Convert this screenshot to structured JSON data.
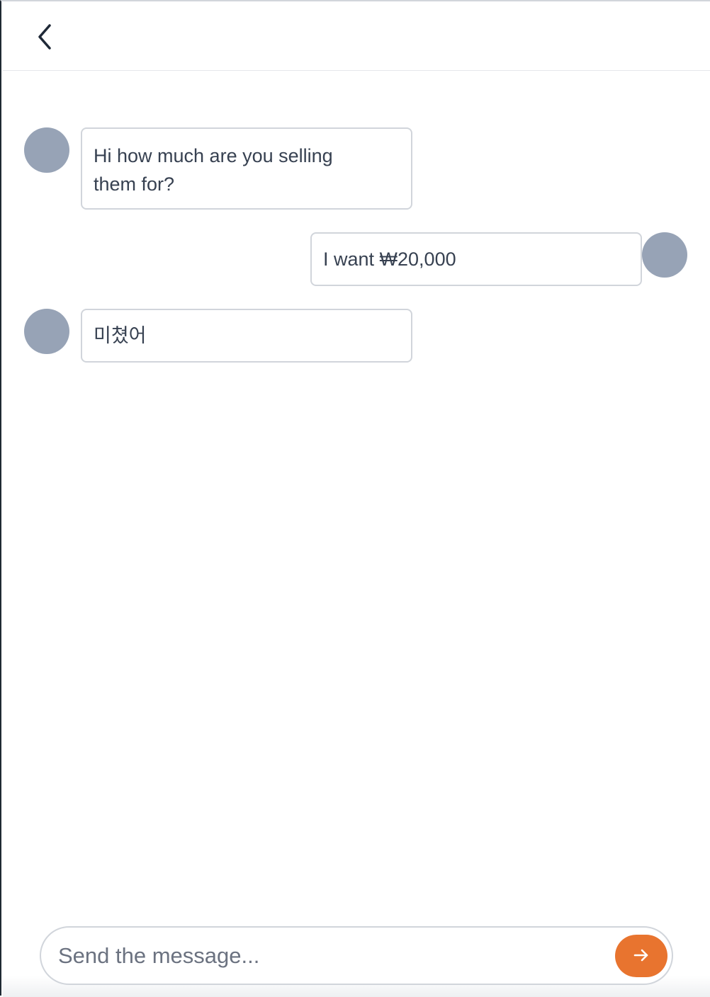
{
  "header": {
    "back_icon": "chevron-left-icon"
  },
  "messages": [
    {
      "sender": "other",
      "text_line1": "Hi how much are you selling",
      "text_line2": "them for?"
    },
    {
      "sender": "me",
      "text": "I want ₩20,000"
    },
    {
      "sender": "other",
      "text": "미쳤어"
    }
  ],
  "composer": {
    "placeholder": "Send the message...",
    "send_icon": "arrow-right-icon"
  },
  "colors": {
    "accent": "#e8742f",
    "avatar": "#97a3b6",
    "bubble_border": "#d1d5db",
    "text": "#374151"
  }
}
